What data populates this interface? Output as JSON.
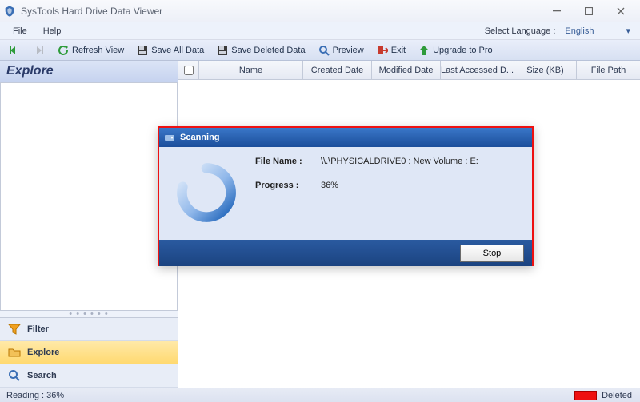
{
  "window": {
    "title": "SysTools Hard Drive Data Viewer"
  },
  "menu": {
    "file": "File",
    "help": "Help",
    "lang_label": "Select Language :",
    "lang_value": "English"
  },
  "toolbar": {
    "refresh": "Refresh View",
    "save_all": "Save All Data",
    "save_deleted": "Save Deleted Data",
    "preview": "Preview",
    "exit": "Exit",
    "upgrade": "Upgrade to Pro"
  },
  "left": {
    "header": "Explore",
    "tabs": {
      "filter": "Filter",
      "explore": "Explore",
      "search": "Search"
    }
  },
  "grid": {
    "cols": {
      "name": "Name",
      "created": "Created Date",
      "modified": "Modified Date",
      "accessed": "Last Accessed D...",
      "size": "Size (KB)",
      "path": "File Path"
    }
  },
  "modal": {
    "title": "Scanning",
    "filename_label": "File Name :",
    "filename_value": "\\\\.\\PHYSICALDRIVE0 : New Volume : E:",
    "progress_label": "Progress :",
    "progress_value": "36%",
    "stop": "Stop"
  },
  "status": {
    "reading": "Reading : 36%",
    "deleted": "Deleted"
  }
}
